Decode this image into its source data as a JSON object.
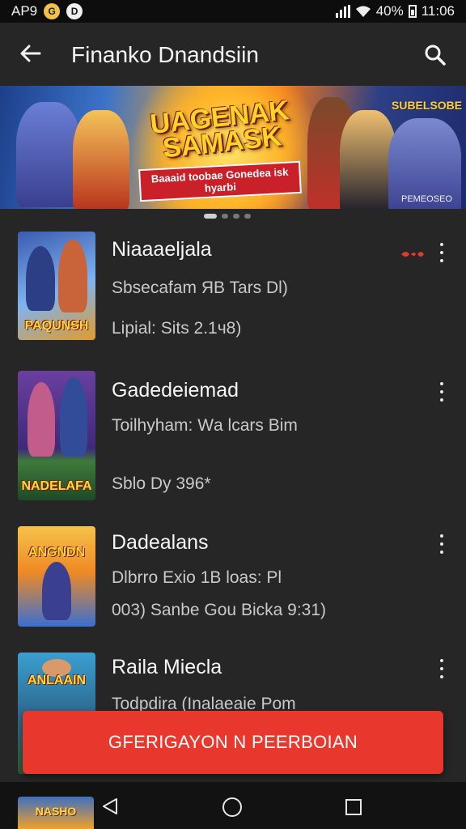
{
  "status_bar": {
    "left_text": "AP9",
    "dot_1": "G",
    "dot_2": "D",
    "battery": "40%",
    "time": "11:06"
  },
  "app_bar": {
    "title": "Finanko Dnandsiin",
    "back_icon": "arrow-back-icon",
    "search_icon": "search-icon"
  },
  "banner": {
    "title": "UAGENAK SAMASK",
    "subtitle": "Baaaid toobae Gonedea isk hyarbi",
    "corner_text": "SUBELSOBE",
    "footer": "PEMEOSEO",
    "pager_active_index": 0,
    "pager_count": 4
  },
  "list": {
    "items": [
      {
        "title": "Niaaaeljala",
        "line1": "Sbsecafam ЯB Tars Dl)",
        "line2": "Lipial: Sits 2.1ч8)",
        "thumb_caption": "PAQUNSH",
        "has_badge": true,
        "colors": [
          "#3a5bb0",
          "#e09b2d"
        ]
      },
      {
        "title": "Gadedeiemad",
        "line1": "Toilhyham: Ԝa lcars Bim",
        "line2": "Sblo Dy 396*",
        "thumb_caption": "NADELAFA",
        "has_badge": false,
        "colors": [
          "#6a3fa0",
          "#3f7a3a"
        ]
      },
      {
        "title": "Dadealans",
        "line1": "Dlbrro Exio 1B loas: Pl",
        "line2": "003) Sanbe Gou Bicka 9:31)",
        "thumb_caption": "ANGNDN",
        "has_badge": false,
        "colors": [
          "#f08a24",
          "#3a6fd0"
        ]
      },
      {
        "title": "Raila Miecla",
        "line1": "Todpdira (Inalaeaie Pom",
        "line2": "",
        "thumb_caption": "ANLAAIN",
        "has_badge": false,
        "colors": [
          "#3a9fd0",
          "#2d5a30"
        ]
      }
    ]
  },
  "cta": {
    "label": "GFERIGAYON N PEERBOIAN",
    "color": "#e8372c"
  },
  "nav": {
    "peek_caption": "NASHO",
    "back_icon": "triangle-back-icon",
    "home_icon": "circle-home-icon",
    "recent_icon": "square-recents-icon"
  }
}
